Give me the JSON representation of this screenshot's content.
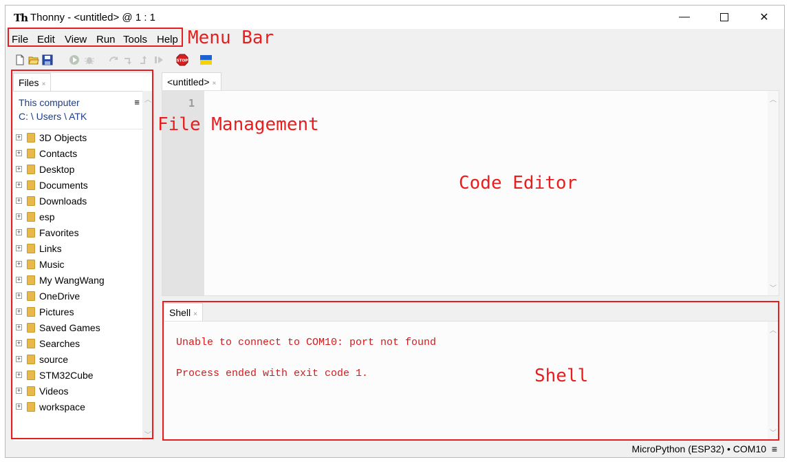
{
  "window": {
    "title": "Thonny  -  <untitled>  @  1 : 1",
    "minimize": "—",
    "close": "✕"
  },
  "menu": {
    "items": [
      "File",
      "Edit",
      "View",
      "Run",
      "Tools",
      "Help"
    ]
  },
  "toolbar": {
    "icons": [
      "new-file-icon",
      "open-file-icon",
      "save-icon",
      "run-icon",
      "debug-icon",
      "step-over-icon",
      "step-into-icon",
      "step-out-icon",
      "resume-icon",
      "stop-icon",
      "ukraine-flag-icon"
    ]
  },
  "files": {
    "tab_label": "Files",
    "tab_close": "×",
    "location_title": "This computer",
    "location_path": "C: \\ Users \\ ATK",
    "menu_icon": "≡",
    "items": [
      "3D Objects",
      "Contacts",
      "Desktop",
      "Documents",
      "Downloads",
      "esp",
      "Favorites",
      "Links",
      "Music",
      "My WangWang",
      "OneDrive",
      "Pictures",
      "Saved Games",
      "Searches",
      "source",
      "STM32Cube",
      "Videos",
      "workspace"
    ]
  },
  "editor": {
    "tab_label": "<untitled>",
    "tab_close": "×",
    "line_number": "1"
  },
  "shell": {
    "tab_label": "Shell",
    "tab_close": "×",
    "lines": [
      "Unable to connect to COM10: port not found",
      "Process ended with exit code 1."
    ]
  },
  "status": {
    "text": "MicroPython (ESP32)  •  COM10",
    "menu_icon": "≡"
  },
  "annotations": {
    "menu_bar": "Menu Bar",
    "file_management": "File Management",
    "code_editor": "Code Editor",
    "shell": "Shell"
  },
  "colors": {
    "annotation": "#e81e1e",
    "shell_text": "#d11b1b",
    "link": "#1a3c8f"
  }
}
